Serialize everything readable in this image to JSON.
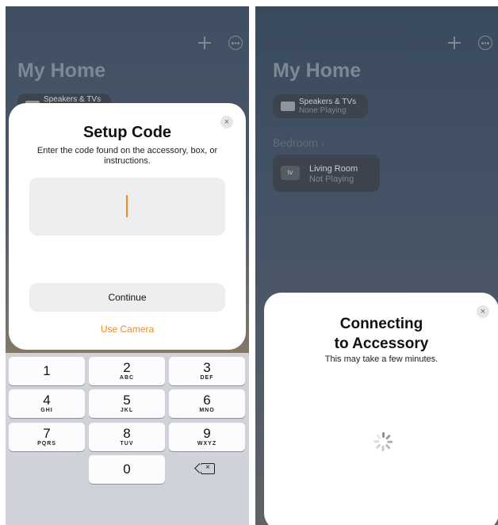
{
  "left": {
    "home_title": "My Home",
    "tile_speakers": {
      "title": "Speakers & TVs"
    },
    "modal": {
      "close_symbol": "×",
      "title": "Setup Code",
      "subtitle": "Enter the code found on the accessory, box, or instructions.",
      "code_value": "",
      "continue_label": "Continue",
      "camera_label": "Use Camera"
    },
    "keypad": [
      {
        "num": "1",
        "letters": ""
      },
      {
        "num": "2",
        "letters": "ABC"
      },
      {
        "num": "3",
        "letters": "DEF"
      },
      {
        "num": "4",
        "letters": "GHI"
      },
      {
        "num": "5",
        "letters": "JKL"
      },
      {
        "num": "6",
        "letters": "MNO"
      },
      {
        "num": "7",
        "letters": "PQRS"
      },
      {
        "num": "8",
        "letters": "TUV"
      },
      {
        "num": "9",
        "letters": "WXYZ"
      },
      {
        "num": "0",
        "letters": ""
      }
    ],
    "delete_symbol": "×"
  },
  "right": {
    "home_title": "My Home",
    "tile_speakers": {
      "title": "Speakers & TVs",
      "status": "None Playing"
    },
    "section_label": "Bedroom ›",
    "tile_living": {
      "icon_label": "tv",
      "title": "Living Room",
      "status": "Not Playing"
    },
    "sheet": {
      "close_symbol": "×",
      "title_line1": "Connecting",
      "title_line2": "to Accessory",
      "subtitle": "This may take a few minutes."
    }
  },
  "colors": {
    "accent": "#f08a1c",
    "modal_bg": "#ffffff",
    "keypad_bg": "#cfd2d8"
  }
}
